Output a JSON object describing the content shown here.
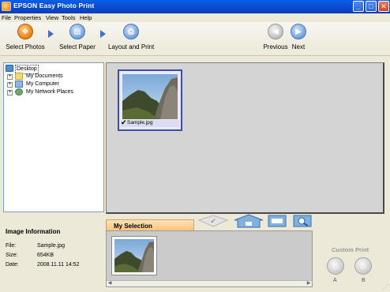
{
  "window": {
    "title": "EPSON Easy Photo Print",
    "minimize": "_",
    "maximize": "□",
    "close": "✕"
  },
  "menu": [
    "File",
    "Properties",
    "View",
    "Tools",
    "Help"
  ],
  "steps": {
    "select_photos": "Select Photos",
    "select_paper": "Select Paper",
    "layout_and_print": "Layout and Print",
    "previous": "Previous",
    "next": "Next"
  },
  "tree": {
    "root": "Desktop",
    "items": [
      "My Documents",
      "My Computer",
      "My Network Places"
    ]
  },
  "photo": {
    "filename": "Sample.jpg",
    "selected": true
  },
  "info": {
    "heading": "Image Information",
    "file_label": "File:",
    "file_value": "Sample.jpg",
    "size_label": "Size:",
    "size_value": "654KB",
    "date_label": "Date:",
    "date_value": "2008.11.11 14:52"
  },
  "selection": {
    "tab_label": "My Selection"
  },
  "custom_print": {
    "label": "Custom Print",
    "a": "A",
    "b": "B"
  },
  "colors": {
    "titlebar": "#0a4bd0",
    "accent_orange": "#f08a1c",
    "accent_blue": "#3a6fd8",
    "selection_tab": "#f8c27a"
  },
  "icons": {
    "select_photos": "photo-icon",
    "select_paper": "paper-icon",
    "layout_and_print": "printer-icon",
    "previous": "arrow-left-icon",
    "next": "arrow-right-icon"
  }
}
